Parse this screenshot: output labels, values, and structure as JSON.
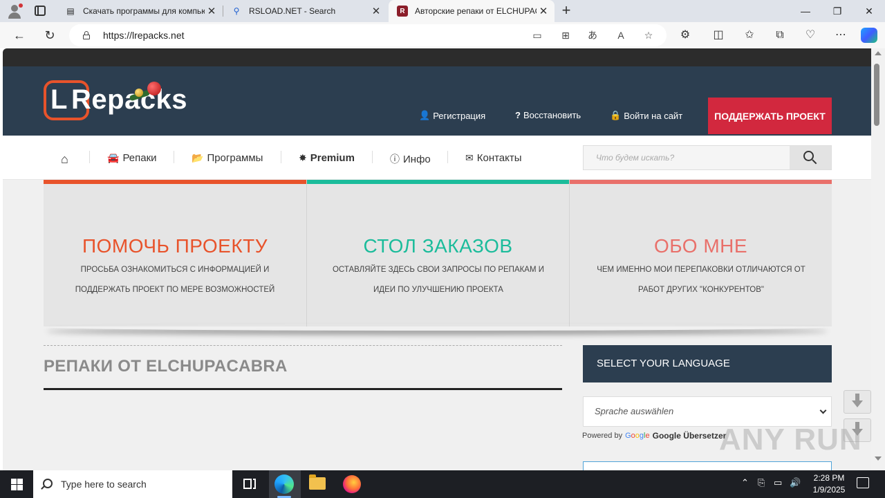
{
  "browser": {
    "tabs": [
      {
        "label": "Скачать программы для компьютера",
        "icon": "news-icon"
      },
      {
        "label": "RSLOAD.NET - Search",
        "icon": "search-icon"
      },
      {
        "label": "Авторские репаки от ELCHUPACABRA",
        "icon": "lrepacks-favicon"
      }
    ],
    "url": "https://lrepacks.net",
    "new_tab": "+",
    "close_glyph": "✕"
  },
  "site": {
    "logo_letter": "L",
    "logo_text": "Repacks",
    "header_links": [
      {
        "label": "Регистрация",
        "icon": "user-plus-icon"
      },
      {
        "label": "Восстановить",
        "icon": "question-icon"
      },
      {
        "label": "Войти на сайт",
        "icon": "lock-icon"
      }
    ],
    "support_button": "ПОДДЕРЖАТЬ ПРОЕКТ",
    "menu": [
      {
        "label": "",
        "icon": "home-icon"
      },
      {
        "label": "Репаки",
        "icon": "car-icon"
      },
      {
        "label": "Программы",
        "icon": "folder-icon"
      },
      {
        "label": "Premium",
        "icon": "star-icon"
      },
      {
        "label": "Инфо",
        "icon": "info-icon"
      },
      {
        "label": "Контакты",
        "icon": "envelope-icon"
      }
    ],
    "search_placeholder": "Что будем искать?",
    "features": [
      {
        "title": "ПОМОЧЬ ПРОЕКТУ",
        "desc": "Просьба ознакомиться с информацией и поддержать проект по мере возможностей",
        "color": "#e8532b"
      },
      {
        "title": "СТОЛ ЗАКАЗОВ",
        "desc": "Оставляйте здесь свои запросы по репакам и идеи по улучшению проекта",
        "color": "#1bbc9b"
      },
      {
        "title": "ОБО МНЕ",
        "desc": "Чем именно мои перепаковки отличаются от работ других \"конкурентов\"",
        "color": "#e9706a"
      }
    ],
    "section_title": "РЕПАКИ ОТ ELCHUPACABRA",
    "language_heading": "SELECT YOUR LANGUAGE",
    "language_select": "Sprache auswählen",
    "powered_by": "Powered by",
    "google": [
      "G",
      "o",
      "o",
      "g",
      "l",
      "e"
    ],
    "translator": "Google Übersetzer",
    "watermark": "ANY RUN"
  },
  "taskbar": {
    "search_text": "Type here to search",
    "time": "2:28 PM",
    "date": "1/9/2025"
  }
}
